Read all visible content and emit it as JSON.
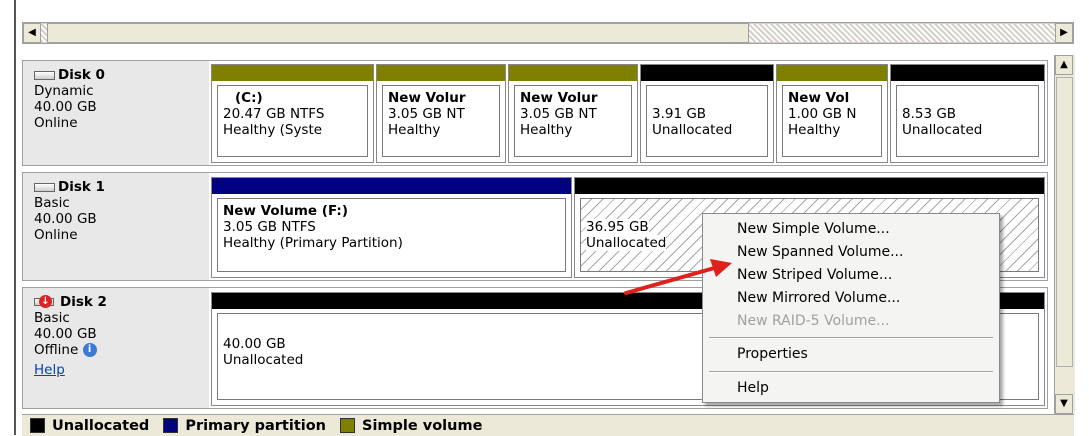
{
  "colors": {
    "unallocated": "#000000",
    "primary": "#000080",
    "simple": "#808000",
    "arrow": "#e0201a"
  },
  "disks": [
    {
      "name": "Disk 0",
      "type": "Dynamic",
      "size": "40.00 GB",
      "status": "Online",
      "partitions": [
        {
          "title": "(C:)",
          "line1": "20.47 GB NTFS",
          "line2": "Healthy (Syste",
          "kind": "simple"
        },
        {
          "title": "New Volur",
          "line1": "3.05 GB NT",
          "line2": "Healthy",
          "kind": "simple"
        },
        {
          "title": "New Volur",
          "line1": "3.05 GB NT",
          "line2": "Healthy",
          "kind": "simple"
        },
        {
          "title": "",
          "line1": "3.91 GB",
          "line2": "Unallocated",
          "kind": "unallocated"
        },
        {
          "title": "New Vol",
          "line1": "1.00 GB N",
          "line2": "Healthy",
          "kind": "simple"
        },
        {
          "title": "",
          "line1": "8.53 GB",
          "line2": "Unallocated",
          "kind": "unallocated"
        }
      ]
    },
    {
      "name": "Disk 1",
      "type": "Basic",
      "size": "40.00 GB",
      "status": "Online",
      "partitions": [
        {
          "title": "New Volume  (F:)",
          "line1": "3.05 GB NTFS",
          "line2": "Healthy (Primary Partition)",
          "kind": "primary"
        },
        {
          "title": "",
          "line1": "36.95 GB",
          "line2": "Unallocated",
          "kind": "unallocated"
        }
      ]
    },
    {
      "name": "Disk 2",
      "type": "Basic",
      "size": "40.00 GB",
      "status": "Offline",
      "help": "Help",
      "partitions": [
        {
          "title": "",
          "line1": "40.00 GB",
          "line2": "Unallocated",
          "kind": "unallocated"
        }
      ]
    }
  ],
  "context_menu": {
    "items": [
      "New Simple Volume...",
      "New Spanned Volume...",
      "New Striped Volume...",
      "New Mirrored Volume...",
      "New RAID-5 Volume...",
      "Properties",
      "Help"
    ]
  },
  "legend": {
    "items": [
      "Unallocated",
      "Primary partition",
      "Simple volume"
    ]
  },
  "scroll": {
    "left_arrow": "◀",
    "right_arrow": "▶",
    "up_arrow": "▲",
    "down_arrow": "▼"
  }
}
